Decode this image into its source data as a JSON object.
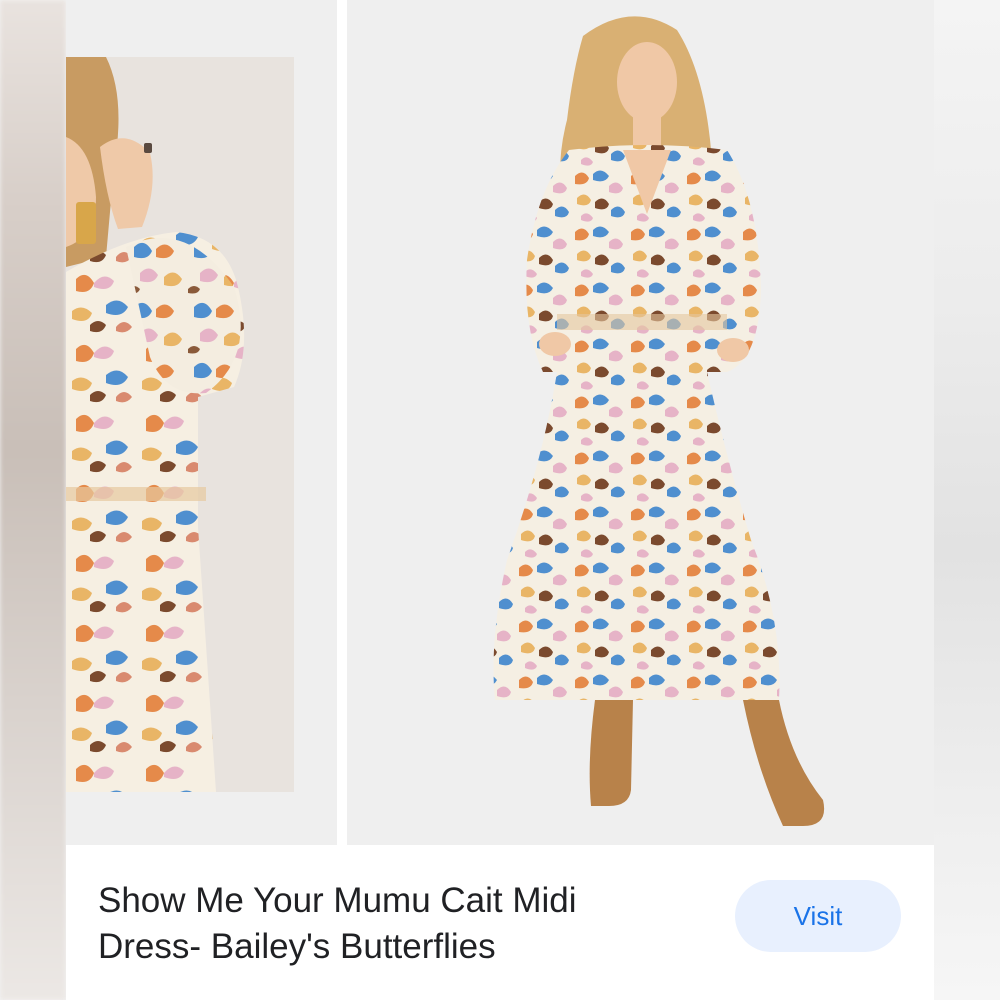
{
  "product": {
    "title_line1": "Show Me Your Mumu Cait Midi",
    "title_line2": "Dress- Bailey's Butterflies",
    "visit_label": "Visit"
  },
  "images": [
    {
      "name": "product-detail-photo",
      "subject": "close-up of butterfly print dress sleeve and bodice"
    },
    {
      "name": "product-full-photo",
      "subject": "model wearing butterfly print midi dress with tan boots"
    }
  ],
  "colors": {
    "visit_bg": "#e8f0fe",
    "visit_text": "#1a73e8",
    "title_text": "#202124",
    "print_palette": [
      "#e58a4a",
      "#4f8fcf",
      "#e6b3c7",
      "#e9b566",
      "#7b4a2e",
      "#f6efe2"
    ],
    "boots": "#b8824a"
  }
}
